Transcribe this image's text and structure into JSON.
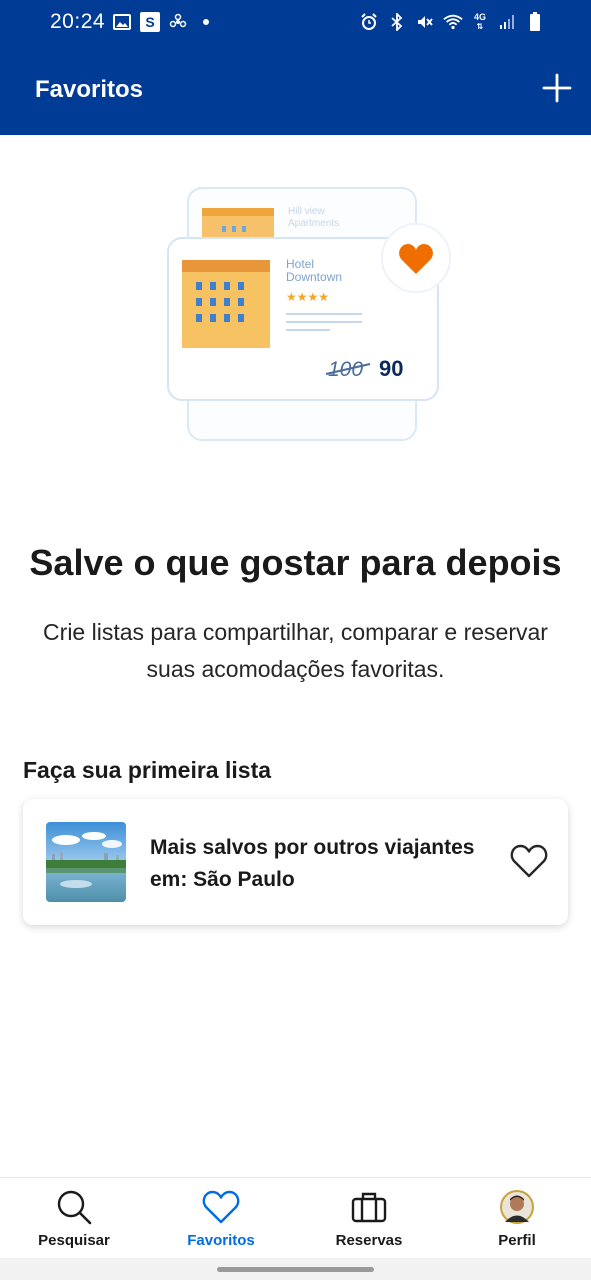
{
  "status_bar": {
    "time": "20:24",
    "network": "4G",
    "icons_left": [
      "image-icon",
      "s-app-icon",
      "fan-icon",
      "dot-icon"
    ],
    "icons_right": [
      "alarm-icon",
      "bluetooth-icon",
      "mute-icon",
      "wifi-icon",
      "signal-icon",
      "battery-icon"
    ]
  },
  "app_bar": {
    "title": "Favoritos",
    "action_icon": "plus-icon"
  },
  "illustration": {
    "back_card_title_line1": "Hill view",
    "back_card_title_line2": "Apartments",
    "front_card_title_line1": "Hotel",
    "front_card_title_line2": "Downtown",
    "old_price": "100",
    "new_price": "90",
    "stars": "★★★★"
  },
  "empty_state": {
    "title": "Salve o que gostar para depois",
    "subtitle": "Crie listas para compartilhar, comparar e reservar suas acomodações favoritas."
  },
  "section": {
    "title": "Faça sua primeira lista"
  },
  "list_card": {
    "line1": "Mais salvos por outros viajantes",
    "line2": "em: São Paulo",
    "icon": "heart-outline-icon"
  },
  "bottom_nav": {
    "items": [
      {
        "label": "Pesquisar",
        "icon": "search-icon",
        "active": false
      },
      {
        "label": "Favoritos",
        "icon": "heart-icon",
        "active": true
      },
      {
        "label": "Reservas",
        "icon": "suitcase-icon",
        "active": false
      },
      {
        "label": "Perfil",
        "icon": "avatar-icon",
        "active": false
      }
    ]
  },
  "colors": {
    "brand_blue": "#003b95",
    "active_blue": "#006ce4",
    "heart_orange": "#f06d00",
    "star_yellow": "#f5a623"
  }
}
